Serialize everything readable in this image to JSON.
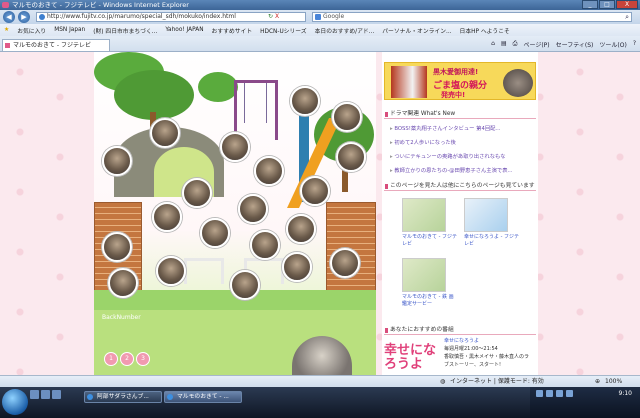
{
  "window": {
    "title": "マルモのおきて - フジテレビ - Windows Internet Explorer",
    "controls": {
      "minimize": "_",
      "maximize": "□",
      "close": "X"
    }
  },
  "address_bar": {
    "back": "◀",
    "forward": "▶",
    "url": "http://www.fujitv.co.jp/marumo/special_sdh/mokuko/index.html",
    "refresh_label": "↻",
    "stop_label": "X",
    "search_placeholder": "Google"
  },
  "favorites_bar": {
    "favorites_label": "お気に入り",
    "items": [
      "MSN Japan",
      "(財) 四日市市まちづく...",
      "Yahoo! JAPAN",
      "おすすめサイト",
      "HDCN-Uシリーズ",
      "本日のおすすめ/アド...",
      "パーソナル・オンライン...",
      "日本HP へようこそ"
    ]
  },
  "tab": {
    "label": "マルモのおきて - フジテレビ"
  },
  "command_bar": {
    "page": "ページ(P)",
    "safety": "セーフティ(S)",
    "tools": "ツール(O)",
    "help": "?"
  },
  "content": {
    "back_number_label": "BackNumber",
    "page_numbers": [
      "1",
      "2",
      "3"
    ],
    "banner": {
      "line1": "黒木愛御用達!",
      "line2": "ごま塩の親分",
      "line3": "発売中!"
    },
    "drama_section": {
      "title": "ドラマ関連 What's New",
      "items": [
        "BOSS!薬丸翔子さんインタビュー 第4回配...",
        "初めて2人歩いになった後",
        "ついにテキュンーの奥路があ取り出されなもな",
        "教師立かりの恩たちの-@田野恵子さん主演で表..."
      ]
    },
    "also_viewed": {
      "title": "このページを見た人は他にこちらのページも見ています",
      "pages": [
        {
          "caption": "マルモのおきて - フジテレビ"
        },
        {
          "caption": "幸せになろうよ - フジテレビ"
        },
        {
          "caption": "マルモのおきて - 鉄 画鑑定サービー"
        }
      ]
    },
    "recommended": {
      "title": "あなたにおすすめの番組",
      "program_title": "幸せになろうよ",
      "lines": [
        "幸せになろうよ",
        "毎週月曜21:00～21:54",
        "香取慎吾・黒木メイサ・藤木直人のラ",
        "ブストーリー、スタート!"
      ]
    }
  },
  "status_bar": {
    "zone": "インターネット | 保護モード: 有効",
    "zoom": "100%"
  },
  "taskbar": {
    "buttons": [
      "阿部サダラさんブ...",
      "マルモのおきて - ..."
    ],
    "time": "9:10"
  }
}
